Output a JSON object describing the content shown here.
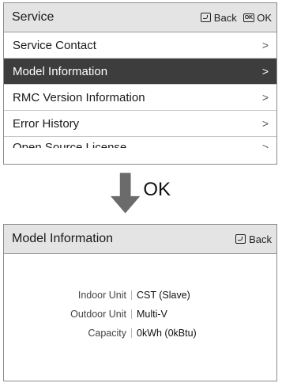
{
  "top_panel": {
    "title": "Service",
    "actions": {
      "back": "Back",
      "ok_icon": "OK",
      "ok": "OK"
    },
    "items": [
      {
        "label": "Service Contact",
        "chevron": ">",
        "selected": false
      },
      {
        "label": "Model Information",
        "chevron": ">",
        "selected": true
      },
      {
        "label": "RMC Version Information",
        "chevron": ">",
        "selected": false
      },
      {
        "label": "Error History",
        "chevron": ">",
        "selected": false
      },
      {
        "label": "Open Source License",
        "chevron": ">",
        "selected": false
      }
    ]
  },
  "transition": {
    "label": "OK",
    "icon": "down-arrow-icon",
    "color": "#6b6b6b"
  },
  "bottom_panel": {
    "title": "Model Information",
    "actions": {
      "back": "Back"
    },
    "rows": [
      {
        "key": "Indoor Unit",
        "value": "CST (Slave)"
      },
      {
        "key": "Outdoor Unit",
        "value": "Multi-V"
      },
      {
        "key": "Capacity",
        "value": "0kWh (0kBtu)"
      }
    ]
  },
  "colors": {
    "header_bg": "#e4e4e4",
    "selected_bg": "#3d3d3d",
    "border": "#8c8c8c"
  }
}
